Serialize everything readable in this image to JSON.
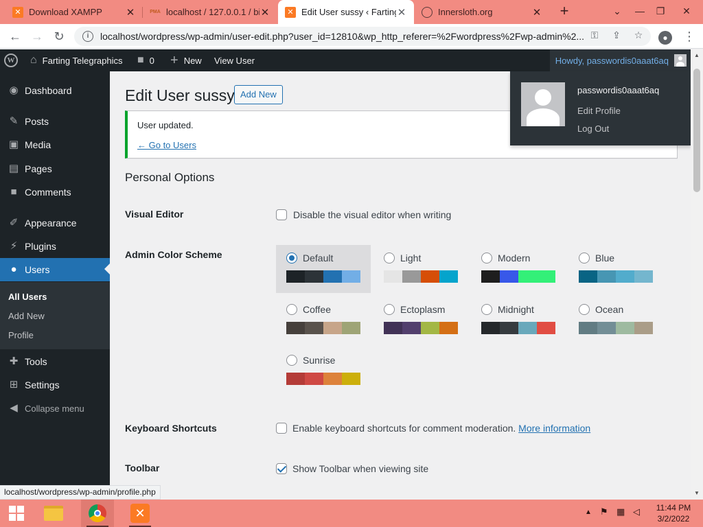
{
  "browser": {
    "tabs": [
      {
        "label": "Download XAMPP",
        "favicon": "xampp-icon"
      },
      {
        "label": "localhost / 127.0.0.1 / bit",
        "favicon": "phpmyadmin-icon",
        "favicon_text": "PMA"
      },
      {
        "label": "Edit User sussy ‹ Farting",
        "favicon": "xampp-icon",
        "active": true
      },
      {
        "label": "Innersloth.org",
        "favicon": "globe-icon"
      }
    ],
    "url": "localhost/wordpress/wp-admin/user-edit.php?user_id=12810&wp_http_referer=%2Fwordpress%2Fwp-admin%2..."
  },
  "adminbar": {
    "site_name": "Farting Telegraphics",
    "comments_count": "0",
    "new_label": "New",
    "view_user_label": "View User",
    "howdy": "Howdy, passwordis0aaat6aq"
  },
  "sidebar": {
    "items": [
      {
        "label": "Dashboard",
        "icon": "dashboard-icon"
      },
      {
        "label": "Posts",
        "icon": "pin-icon"
      },
      {
        "label": "Media",
        "icon": "media-icon"
      },
      {
        "label": "Pages",
        "icon": "pages-icon"
      },
      {
        "label": "Comments",
        "icon": "comment-icon"
      },
      {
        "label": "Appearance",
        "icon": "brush-icon"
      },
      {
        "label": "Plugins",
        "icon": "plug-icon"
      },
      {
        "label": "Users",
        "icon": "user-icon",
        "current": true
      },
      {
        "label": "Tools",
        "icon": "wrench-icon"
      },
      {
        "label": "Settings",
        "icon": "settings-icon"
      },
      {
        "label": "Collapse menu",
        "icon": "collapse-icon"
      }
    ],
    "submenu": [
      {
        "label": "All Users",
        "current": true
      },
      {
        "label": "Add New"
      },
      {
        "label": "Profile"
      }
    ]
  },
  "main": {
    "title": "Edit User sussy",
    "add_new_label": "Add New",
    "notice_text": "User updated.",
    "notice_link": "← Go to Users",
    "section_title": "Personal Options",
    "visual_editor": {
      "label": "Visual Editor",
      "checkbox_label": "Disable the visual editor when writing",
      "checked": false
    },
    "color_scheme": {
      "label": "Admin Color Scheme",
      "selected": "Default",
      "schemes": [
        {
          "name": "Default",
          "colors": [
            "#1d2327",
            "#2c3338",
            "#2271b1",
            "#72aee6"
          ]
        },
        {
          "name": "Light",
          "colors": [
            "#e5e5e5",
            "#999999",
            "#d64e07",
            "#04a4cc"
          ]
        },
        {
          "name": "Modern",
          "colors": [
            "#1e1e1e",
            "#3858e9",
            "#33f078",
            "#33f078"
          ]
        },
        {
          "name": "Blue",
          "colors": [
            "#096484",
            "#4796b3",
            "#52accc",
            "#74b6ce"
          ]
        },
        {
          "name": "Coffee",
          "colors": [
            "#46403c",
            "#59524c",
            "#c7a589",
            "#9ea476"
          ]
        },
        {
          "name": "Ectoplasm",
          "colors": [
            "#413256",
            "#523f6d",
            "#a3b745",
            "#d46f15"
          ]
        },
        {
          "name": "Midnight",
          "colors": [
            "#25282b",
            "#363b3f",
            "#69a8bb",
            "#e14d43"
          ]
        },
        {
          "name": "Ocean",
          "colors": [
            "#627c83",
            "#738e96",
            "#9ebaa0",
            "#aa9d88"
          ]
        },
        {
          "name": "Sunrise",
          "colors": [
            "#b43c38",
            "#cf4944",
            "#dd823b",
            "#ccaf0b"
          ]
        }
      ]
    },
    "keyboard_shortcuts": {
      "label": "Keyboard Shortcuts",
      "checkbox_label": "Enable keyboard shortcuts for comment moderation.",
      "link": "More information",
      "checked": false
    },
    "toolbar": {
      "label": "Toolbar",
      "checkbox_label": "Show Toolbar when viewing site",
      "checked": true
    }
  },
  "account_menu": {
    "username": "passwordis0aaat6aq",
    "edit_profile": "Edit Profile",
    "log_out": "Log Out"
  },
  "status_url": "localhost/wordpress/wp-admin/profile.php",
  "taskbar": {
    "time": "11:44 PM",
    "date": "3/2/2022"
  }
}
